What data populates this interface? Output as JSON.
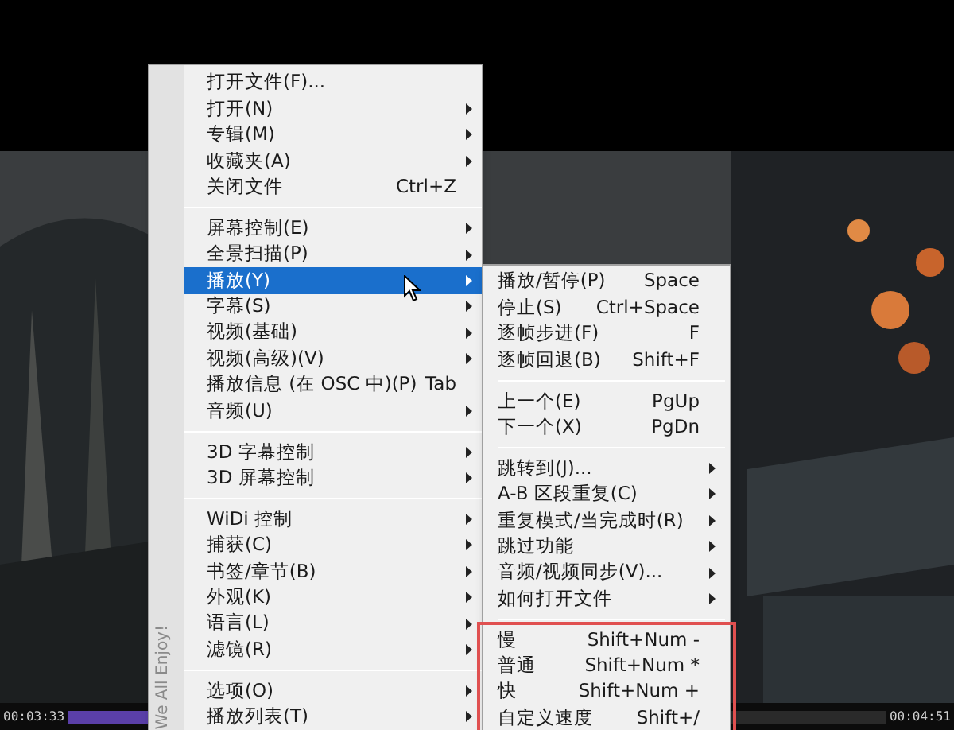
{
  "seek_bar": {
    "elapsed": "00:03:33",
    "total": "00:04:51",
    "level": 0.73
  },
  "context_menu": {
    "side_text": "We All Enjoy!",
    "sections": [
      {
        "items": [
          {
            "label": "打开文件(F)...",
            "submenu": false,
            "selected": false
          },
          {
            "label": "打开(N)",
            "submenu": true,
            "selected": false
          },
          {
            "label": "专辑(M)",
            "submenu": true,
            "selected": false
          },
          {
            "label": "收藏夹(A)",
            "submenu": true,
            "selected": false
          },
          {
            "label": "关闭文件",
            "shortcut": "Ctrl+Z",
            "submenu": false,
            "selected": false
          }
        ]
      },
      {
        "items": [
          {
            "label": "屏幕控制(E)",
            "submenu": true,
            "selected": false
          },
          {
            "label": "全景扫描(P)",
            "submenu": true,
            "selected": false
          },
          {
            "label": "播放(Y)",
            "submenu": true,
            "selected": true
          },
          {
            "label": "字幕(S)",
            "submenu": true,
            "selected": false
          },
          {
            "label": "视频(基础)",
            "submenu": true,
            "selected": false
          },
          {
            "label": "视频(高级)(V)",
            "submenu": true,
            "selected": false
          },
          {
            "label": "播放信息 (在 OSC 中)(P)",
            "shortcut": "Tab",
            "submenu": false,
            "selected": false
          },
          {
            "label": "音频(U)",
            "submenu": true,
            "selected": false
          }
        ]
      },
      {
        "items": [
          {
            "label": "3D 字幕控制",
            "submenu": true,
            "selected": false
          },
          {
            "label": "3D 屏幕控制",
            "submenu": true,
            "selected": false
          }
        ]
      },
      {
        "items": [
          {
            "label": "WiDi 控制",
            "submenu": true,
            "selected": false
          },
          {
            "label": "捕获(C)",
            "submenu": true,
            "selected": false
          },
          {
            "label": "书签/章节(B)",
            "submenu": true,
            "selected": false
          },
          {
            "label": "外观(K)",
            "submenu": true,
            "selected": false
          },
          {
            "label": "语言(L)",
            "submenu": true,
            "selected": false
          },
          {
            "label": "滤镜(R)",
            "submenu": true,
            "selected": false
          }
        ]
      },
      {
        "items": [
          {
            "label": "选项(O)",
            "submenu": true,
            "selected": false
          },
          {
            "label": "播放列表(T)",
            "submenu": true,
            "selected": false
          }
        ]
      }
    ]
  },
  "playback_submenu": {
    "sections": [
      {
        "outlined": false,
        "items": [
          {
            "label": "播放/暂停(P)",
            "shortcut": "Space",
            "submenu": false
          },
          {
            "label": "停止(S)",
            "shortcut": "Ctrl+Space",
            "submenu": false
          },
          {
            "label": "逐帧步进(F)",
            "shortcut": "F",
            "submenu": false
          },
          {
            "label": "逐帧回退(B)",
            "shortcut": "Shift+F",
            "submenu": false
          }
        ]
      },
      {
        "outlined": false,
        "items": [
          {
            "label": "上一个(E)",
            "shortcut": "PgUp",
            "submenu": false
          },
          {
            "label": "下一个(X)",
            "shortcut": "PgDn",
            "submenu": false
          }
        ]
      },
      {
        "outlined": false,
        "items": [
          {
            "label": "跳转到(J)...",
            "submenu": true
          },
          {
            "label": "A-B 区段重复(C)",
            "submenu": true
          },
          {
            "label": "重复模式/当完成时(R)",
            "submenu": true
          },
          {
            "label": "跳过功能",
            "submenu": true
          },
          {
            "label": "音频/视频同步(V)...",
            "submenu": true
          },
          {
            "label": "如何打开文件",
            "submenu": true
          }
        ]
      },
      {
        "outlined": true,
        "items": [
          {
            "label": "慢",
            "shortcut": "Shift+Num -",
            "submenu": false
          },
          {
            "label": "普通",
            "shortcut": "Shift+Num *",
            "submenu": false
          },
          {
            "label": "快",
            "shortcut": "Shift+Num +",
            "submenu": false
          },
          {
            "label": "自定义速度",
            "shortcut": "Shift+/",
            "submenu": false
          }
        ]
      }
    ]
  }
}
